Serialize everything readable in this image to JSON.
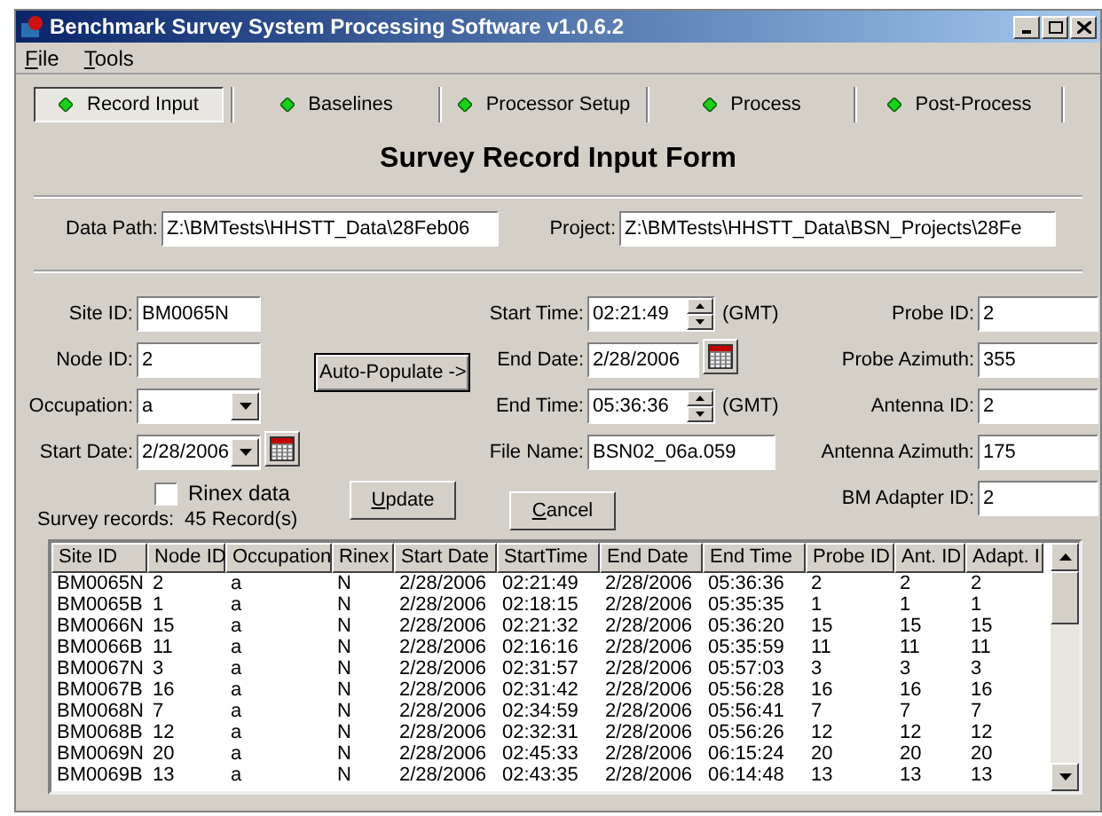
{
  "window": {
    "title": "Benchmark Survey System Processing Software v1.0.6.2"
  },
  "menu": [
    {
      "label": "File"
    },
    {
      "label": "Tools"
    }
  ],
  "tabs": [
    {
      "label": "Record Input",
      "selected": true
    },
    {
      "label": "Baselines",
      "selected": false
    },
    {
      "label": "Processor Setup",
      "selected": false
    },
    {
      "label": "Process",
      "selected": false
    },
    {
      "label": "Post-Process",
      "selected": false
    }
  ],
  "form_title": "Survey Record Input Form",
  "data_path": {
    "label": "Data Path:",
    "value": "Z:\\BMTests\\HHSTT_Data\\28Feb06"
  },
  "project": {
    "label": "Project:",
    "value": "Z:\\BMTests\\HHSTT_Data\\BSN_Projects\\28Fe"
  },
  "left_fields": [
    {
      "kind": "text",
      "label": "Site ID:",
      "value": "BM0065N"
    },
    {
      "kind": "text",
      "label": "Node ID:",
      "value": "2"
    },
    {
      "kind": "combo",
      "label": "Occupation:",
      "value": "a"
    },
    {
      "kind": "date",
      "label": "Start Date:",
      "value": "2/28/2006"
    }
  ],
  "rinex": {
    "label": "Rinex data",
    "checked": false
  },
  "auto_populate": "Auto-Populate ->",
  "middle_fields": [
    {
      "kind": "time",
      "label": "Start Time:",
      "value": "02:21:49",
      "suffix": "(GMT)"
    },
    {
      "kind": "date",
      "label": "End Date:",
      "value": "2/28/2006"
    },
    {
      "kind": "time",
      "label": "End Time:",
      "value": "05:36:36",
      "suffix": "(GMT)"
    },
    {
      "kind": "text",
      "label": "File Name:",
      "value": "BSN02_06a.059"
    }
  ],
  "right_fields": [
    {
      "label": "Probe ID:",
      "value": "2"
    },
    {
      "label": "Probe Azimuth:",
      "value": "355"
    },
    {
      "label": "Antenna ID:",
      "value": "2"
    },
    {
      "label": "Antenna Azimuth:",
      "value": "175"
    },
    {
      "label": "BM Adapter ID:",
      "value": "2"
    }
  ],
  "buttons": [
    "Update",
    "Cancel"
  ],
  "records": {
    "label": "Survey records:",
    "count": "45 Record(s)"
  },
  "table": {
    "columns": [
      "Site ID",
      "Node ID",
      "Occupation",
      "Rinex",
      "Start Date",
      "StartTime",
      "End Date",
      "End Time",
      "Probe ID",
      "Ant. ID",
      "Adapt. I"
    ],
    "rows": [
      [
        "BM0065N",
        "2",
        "a",
        "N",
        "2/28/2006",
        "02:21:49",
        "2/28/2006",
        "05:36:36",
        "2",
        "2",
        "2"
      ],
      [
        "BM0065B",
        "1",
        "a",
        "N",
        "2/28/2006",
        "02:18:15",
        "2/28/2006",
        "05:35:35",
        "1",
        "1",
        "1"
      ],
      [
        "BM0066N",
        "15",
        "a",
        "N",
        "2/28/2006",
        "02:21:32",
        "2/28/2006",
        "05:36:20",
        "15",
        "15",
        "15"
      ],
      [
        "BM0066B",
        "11",
        "a",
        "N",
        "2/28/2006",
        "02:16:16",
        "2/28/2006",
        "05:35:59",
        "11",
        "11",
        "11"
      ],
      [
        "BM0067N",
        "3",
        "a",
        "N",
        "2/28/2006",
        "02:31:57",
        "2/28/2006",
        "05:57:03",
        "3",
        "3",
        "3"
      ],
      [
        "BM0067B",
        "16",
        "a",
        "N",
        "2/28/2006",
        "02:31:42",
        "2/28/2006",
        "05:56:28",
        "16",
        "16",
        "16"
      ],
      [
        "BM0068N",
        "7",
        "a",
        "N",
        "2/28/2006",
        "02:34:59",
        "2/28/2006",
        "05:56:41",
        "7",
        "7",
        "7"
      ],
      [
        "BM0068B",
        "12",
        "a",
        "N",
        "2/28/2006",
        "02:32:31",
        "2/28/2006",
        "05:56:26",
        "12",
        "12",
        "12"
      ],
      [
        "BM0069N",
        "20",
        "a",
        "N",
        "2/28/2006",
        "02:45:33",
        "2/28/2006",
        "06:15:24",
        "20",
        "20",
        "20"
      ],
      [
        "BM0069B",
        "13",
        "a",
        "N",
        "2/28/2006",
        "02:43:35",
        "2/28/2006",
        "06:14:48",
        "13",
        "13",
        "13"
      ]
    ]
  }
}
